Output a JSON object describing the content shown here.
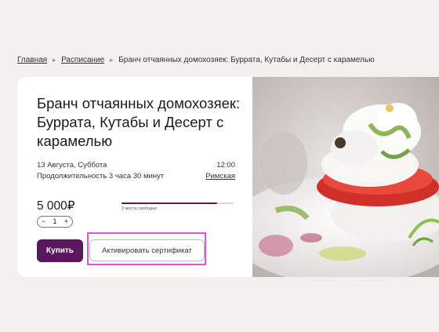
{
  "breadcrumb": {
    "items": [
      "Главная",
      "Расписание",
      "Бранч отчаянных домохозяек: Буррата, Кутабы и Десерт с карамелью"
    ]
  },
  "event": {
    "title": "Бранч отчаянных домохозяек: Буррата, Кутабы и Десерт с карамелью",
    "date": "13 Августа, Суббота",
    "time": "12:00",
    "duration": "Продолжительность 3 часа 30 минут",
    "venue": "Римская",
    "price": "5 000₽",
    "quantity": "1",
    "qty_minus": "−",
    "qty_plus": "+",
    "seats_label": "3 места свободно",
    "seats_fill_fraction": 0.85
  },
  "buttons": {
    "buy": "Купить",
    "certificate": "Активировать сертификат"
  },
  "icons": {
    "breadcrumb_separator": "chevron-right-icon",
    "minus": "minus-icon",
    "plus": "plus-icon"
  },
  "colors": {
    "accent": "#5a175e",
    "highlight": "#e254d6"
  }
}
